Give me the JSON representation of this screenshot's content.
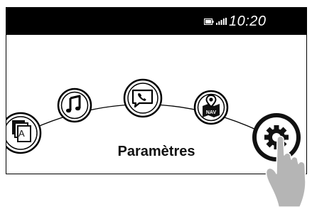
{
  "status_bar": {
    "time": "10:20",
    "battery_icon": "battery-icon",
    "signal_icon": "signal-bars-icon"
  },
  "menu": {
    "title": "Paramètres",
    "items": [
      {
        "icon": "media-source-icon",
        "label": "A"
      },
      {
        "icon": "music-note-icon"
      },
      {
        "icon": "phone-message-icon"
      },
      {
        "icon": "navigation-map-icon",
        "label": "NAV"
      },
      {
        "icon": "settings-gear-icon",
        "selected": true
      }
    ]
  },
  "pointer": {
    "icon": "tapping-hand-icon"
  }
}
